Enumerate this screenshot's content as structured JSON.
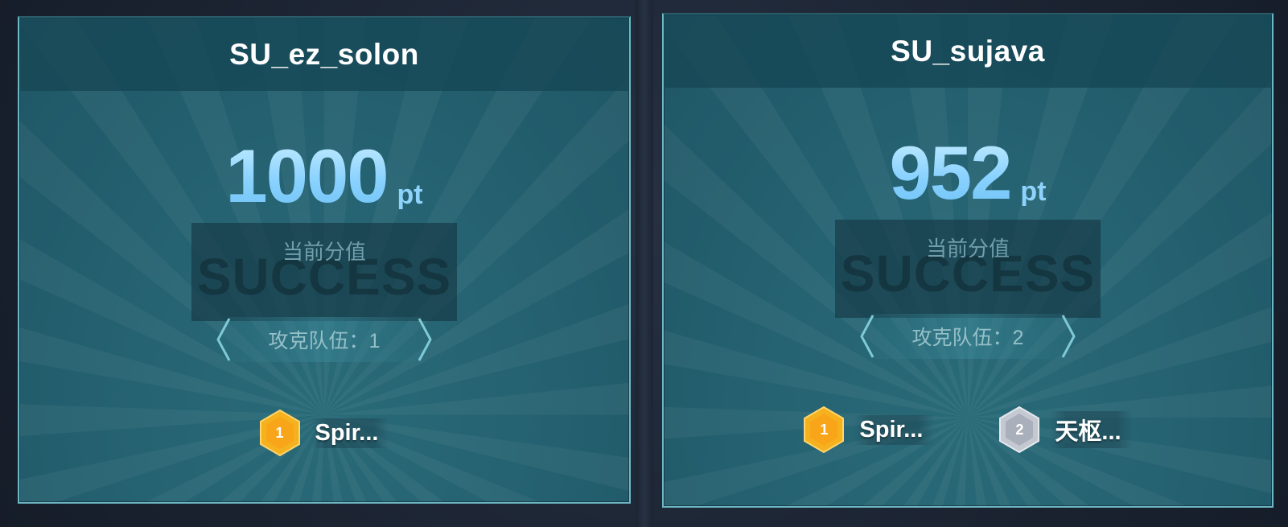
{
  "cards": [
    {
      "title": "SU_ez_solon",
      "score": "1000",
      "unit": "pt",
      "score_label": "当前分值",
      "status_watermark": "SUCCESS",
      "team_count_text": "攻克队伍：1",
      "solvers": [
        {
          "rank": "1",
          "name": "Spir...",
          "medal": "gold"
        }
      ]
    },
    {
      "title": "SU_sujava",
      "score": "952",
      "unit": "pt",
      "score_label": "当前分值",
      "status_watermark": "SUCCESS",
      "team_count_text": "攻克队伍：2",
      "solvers": [
        {
          "rank": "1",
          "name": "Spir...",
          "medal": "gold"
        },
        {
          "rank": "2",
          "name": "天枢...",
          "medal": "silver"
        }
      ]
    }
  ],
  "colors": {
    "gold_medal": "#f6b21e",
    "silver_medal": "#b8bec8",
    "score_text": "#8ad2ff",
    "card_border": "#6db7c4"
  }
}
